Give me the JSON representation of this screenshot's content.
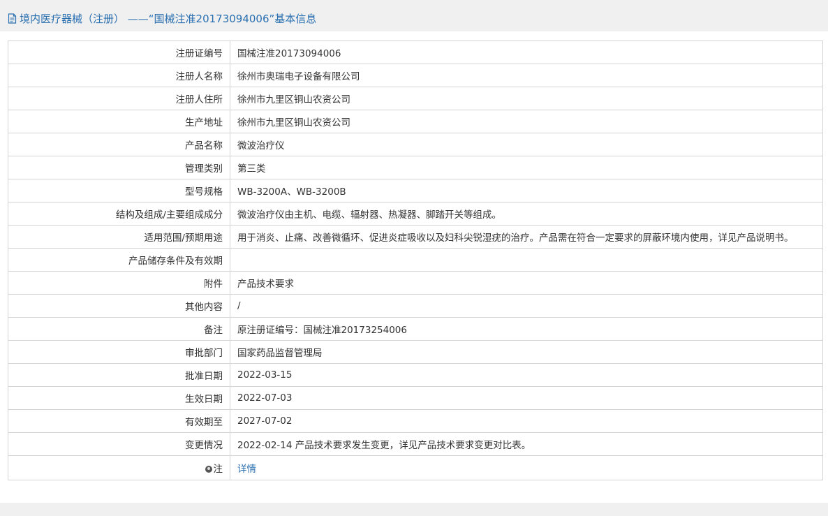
{
  "header": {
    "title": "境内医疗器械（注册） ——“国械注准20173094006”基本信息",
    "icon": "document-icon"
  },
  "rows": [
    {
      "label": "注册证编号",
      "value": "国械注准20173094006"
    },
    {
      "label": "注册人名称",
      "value": "徐州市奥瑞电子设备有限公司"
    },
    {
      "label": "注册人住所",
      "value": "徐州市九里区铜山农资公司"
    },
    {
      "label": "生产地址",
      "value": "徐州市九里区铜山农资公司"
    },
    {
      "label": "产品名称",
      "value": "微波治疗仪"
    },
    {
      "label": "管理类别",
      "value": "第三类"
    },
    {
      "label": "型号规格",
      "value": "WB-3200A、WB-3200B"
    },
    {
      "label": "结构及组成/主要组成成分",
      "value": "微波治疗仪由主机、电缆、辐射器、热凝器、脚踏开关等组成。"
    },
    {
      "label": "适用范围/预期用途",
      "value": "用于消炎、止痛、改善微循环、促进炎症吸收以及妇科尖锐湿疣的治疗。产品需在符合一定要求的屏蔽环境内使用，详见产品说明书。"
    },
    {
      "label": "产品储存条件及有效期",
      "value": ""
    },
    {
      "label": "附件",
      "value": "产品技术要求"
    },
    {
      "label": "其他内容",
      "value": "/"
    },
    {
      "label": "备注",
      "value": "原注册证编号：国械注准20173254006"
    },
    {
      "label": "审批部门",
      "value": "国家药品监督管理局"
    },
    {
      "label": "批准日期",
      "value": "2022-03-15"
    },
    {
      "label": "生效日期",
      "value": "2022-07-03"
    },
    {
      "label": "有效期至",
      "value": "2027-07-02"
    },
    {
      "label": "变更情况",
      "value": "2022-02-14 产品技术要求发生变更，详见产品技术要求变更对比表。"
    }
  ],
  "note": {
    "label": "注",
    "icon": "note-icon",
    "link_text": "详情"
  },
  "colors": {
    "accent": "#2a6fb0",
    "header_bg": "#f0f0f0",
    "border": "#d4d4d4",
    "text": "#333333"
  }
}
